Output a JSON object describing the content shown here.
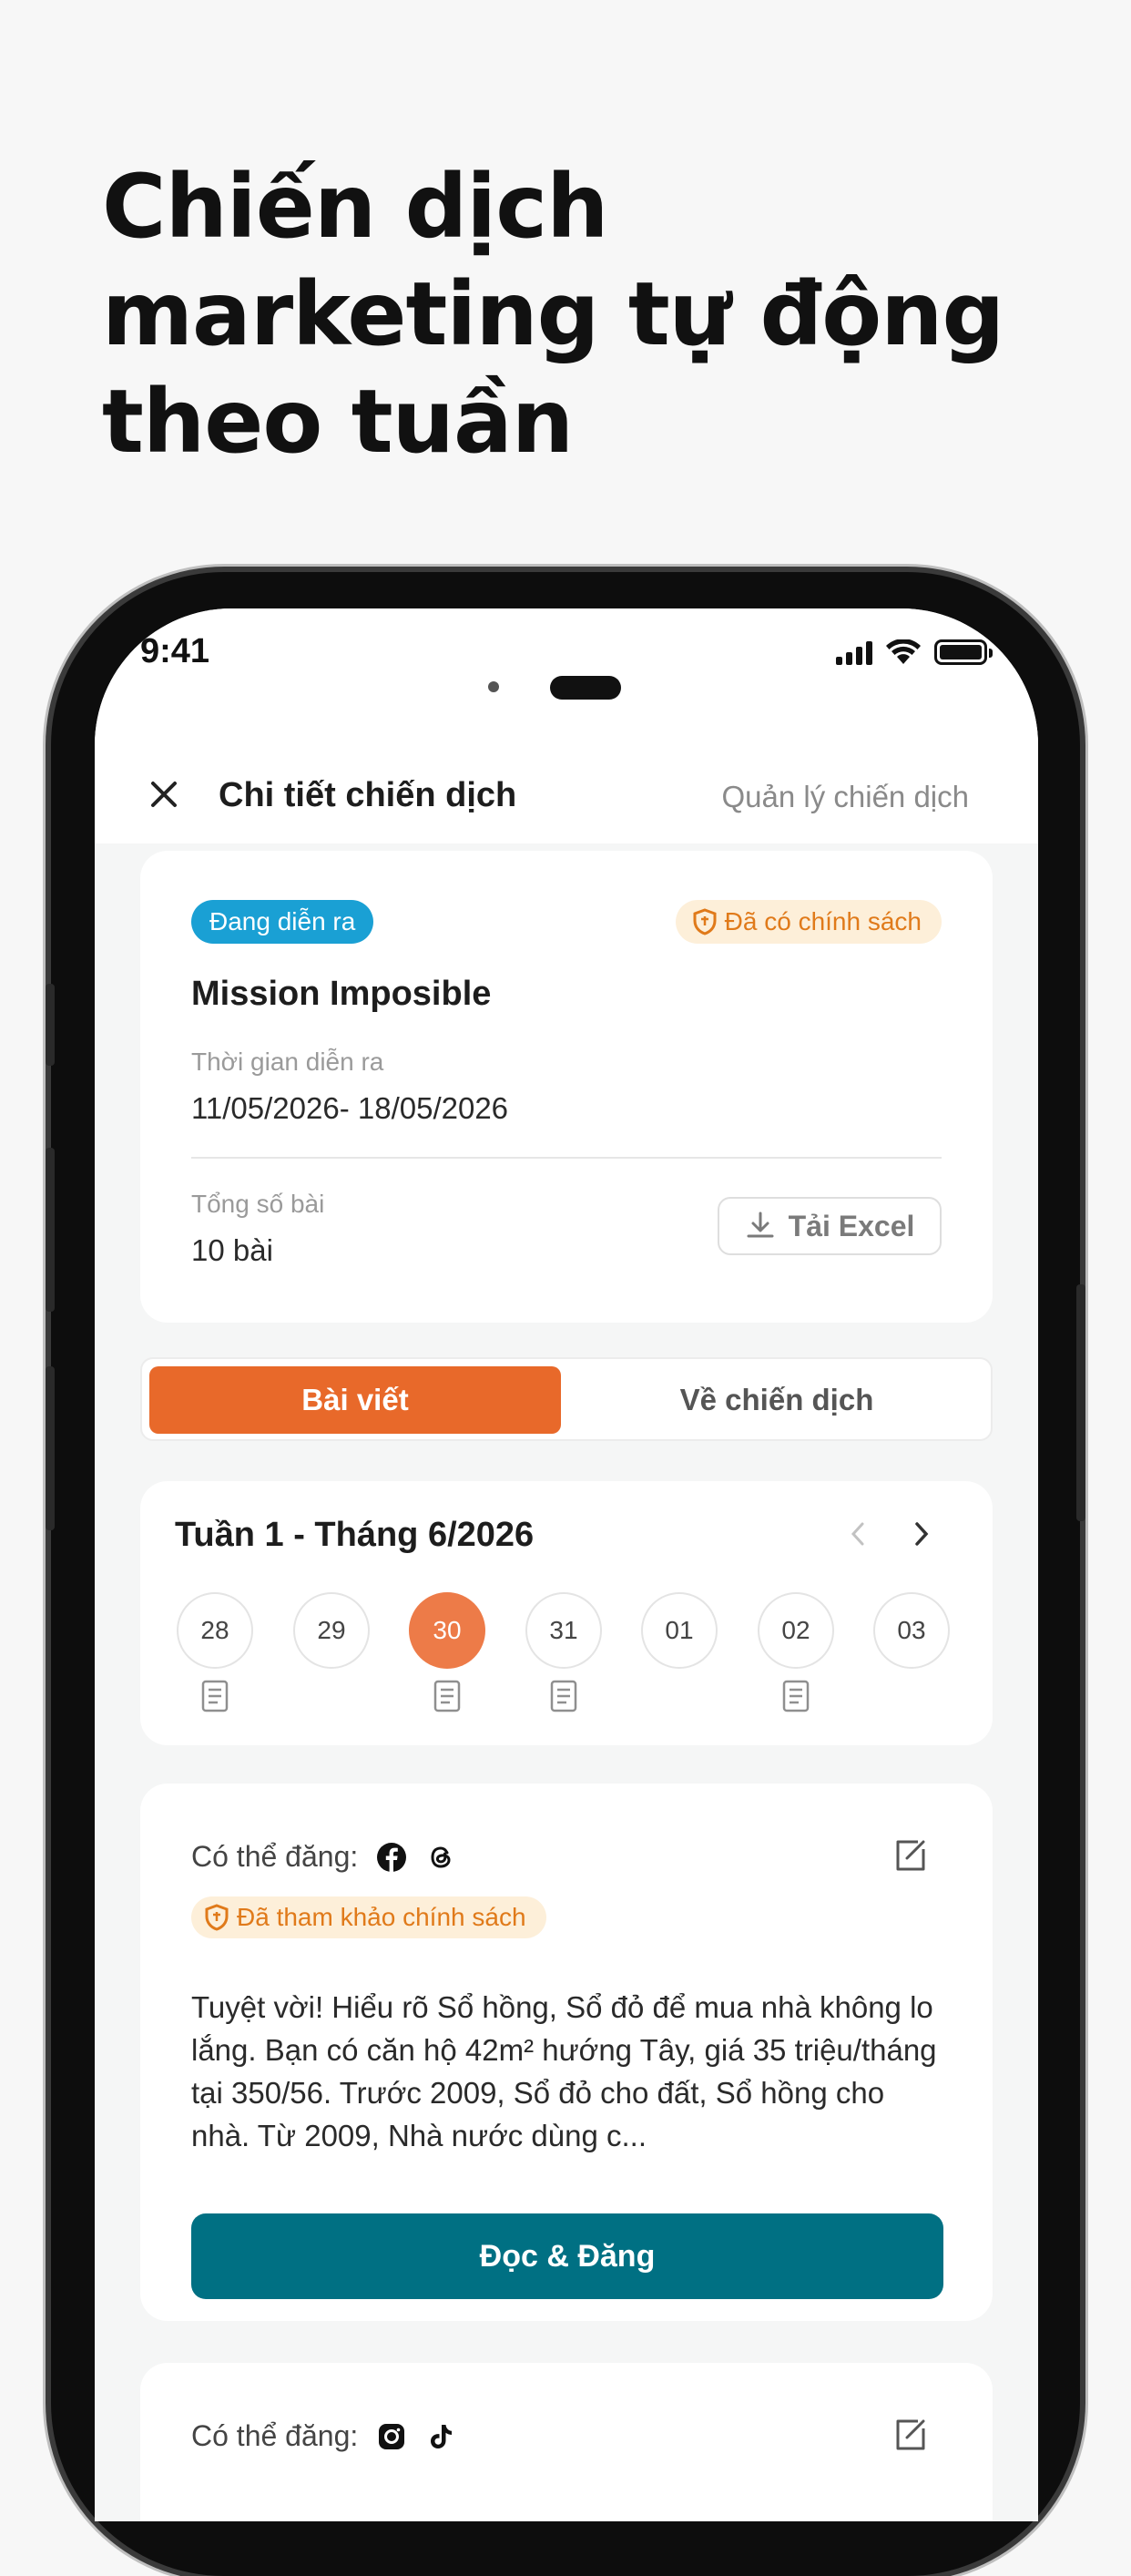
{
  "promo": {
    "title": "Chiến dịch marketing tự động theo tuần"
  },
  "status_bar": {
    "time": "9:41"
  },
  "nav": {
    "title": "Chi tiết chiến dịch",
    "manage_link": "Quản lý chiến dịch",
    "close_icon": "close-icon"
  },
  "campaign": {
    "status_badge": "Đang diễn ra",
    "policy_badge": "Đã có chính sách",
    "name": "Mission Imposible",
    "period_label": "Thời gian diễn ra",
    "period_value": "11/05/2026- 18/05/2026",
    "total_label": "Tổng số bài",
    "total_value": "10 bài",
    "excel_button": "Tải Excel"
  },
  "tabs": [
    {
      "label": "Bài viết",
      "active": true
    },
    {
      "label": "Về chiến dịch",
      "active": false
    }
  ],
  "week": {
    "title": "Tuần 1 - Tháng 6/2026",
    "days": [
      {
        "label": "28",
        "has_post": true,
        "selected": false
      },
      {
        "label": "29",
        "has_post": false,
        "selected": false
      },
      {
        "label": "30",
        "has_post": true,
        "selected": true
      },
      {
        "label": "31",
        "has_post": true,
        "selected": false
      },
      {
        "label": "01",
        "has_post": false,
        "selected": false
      },
      {
        "label": "02",
        "has_post": true,
        "selected": false
      },
      {
        "label": "03",
        "has_post": false,
        "selected": false
      }
    ]
  },
  "posts": [
    {
      "can_post_label": "Có thể đăng:",
      "platforms": [
        "facebook-icon",
        "threads-icon"
      ],
      "ref_badge": "Đã tham khảo chính sách",
      "text": "Tuyệt vời! Hiểu rõ Sổ hồng, Sổ đỏ để mua nhà không lo lắng. Bạn có căn hộ 42m² hướng Tây, giá 35 triệu/tháng tại 350/56. Trước 2009, Sổ đỏ cho đất, Sổ hồng cho nhà. Từ 2009, Nhà nước dùng c...",
      "button": "Đọc & Đăng"
    },
    {
      "can_post_label": "Có thể đăng:",
      "platforms": [
        "instagram-icon",
        "tiktok-icon"
      ]
    }
  ],
  "colors": {
    "accent_orange": "#e8692a",
    "selected_day": "#ed7b48",
    "primary_teal": "#007083",
    "badge_blue": "#1aa0d4",
    "policy_bg": "#fdefd9",
    "policy_text": "#e07a1a"
  }
}
